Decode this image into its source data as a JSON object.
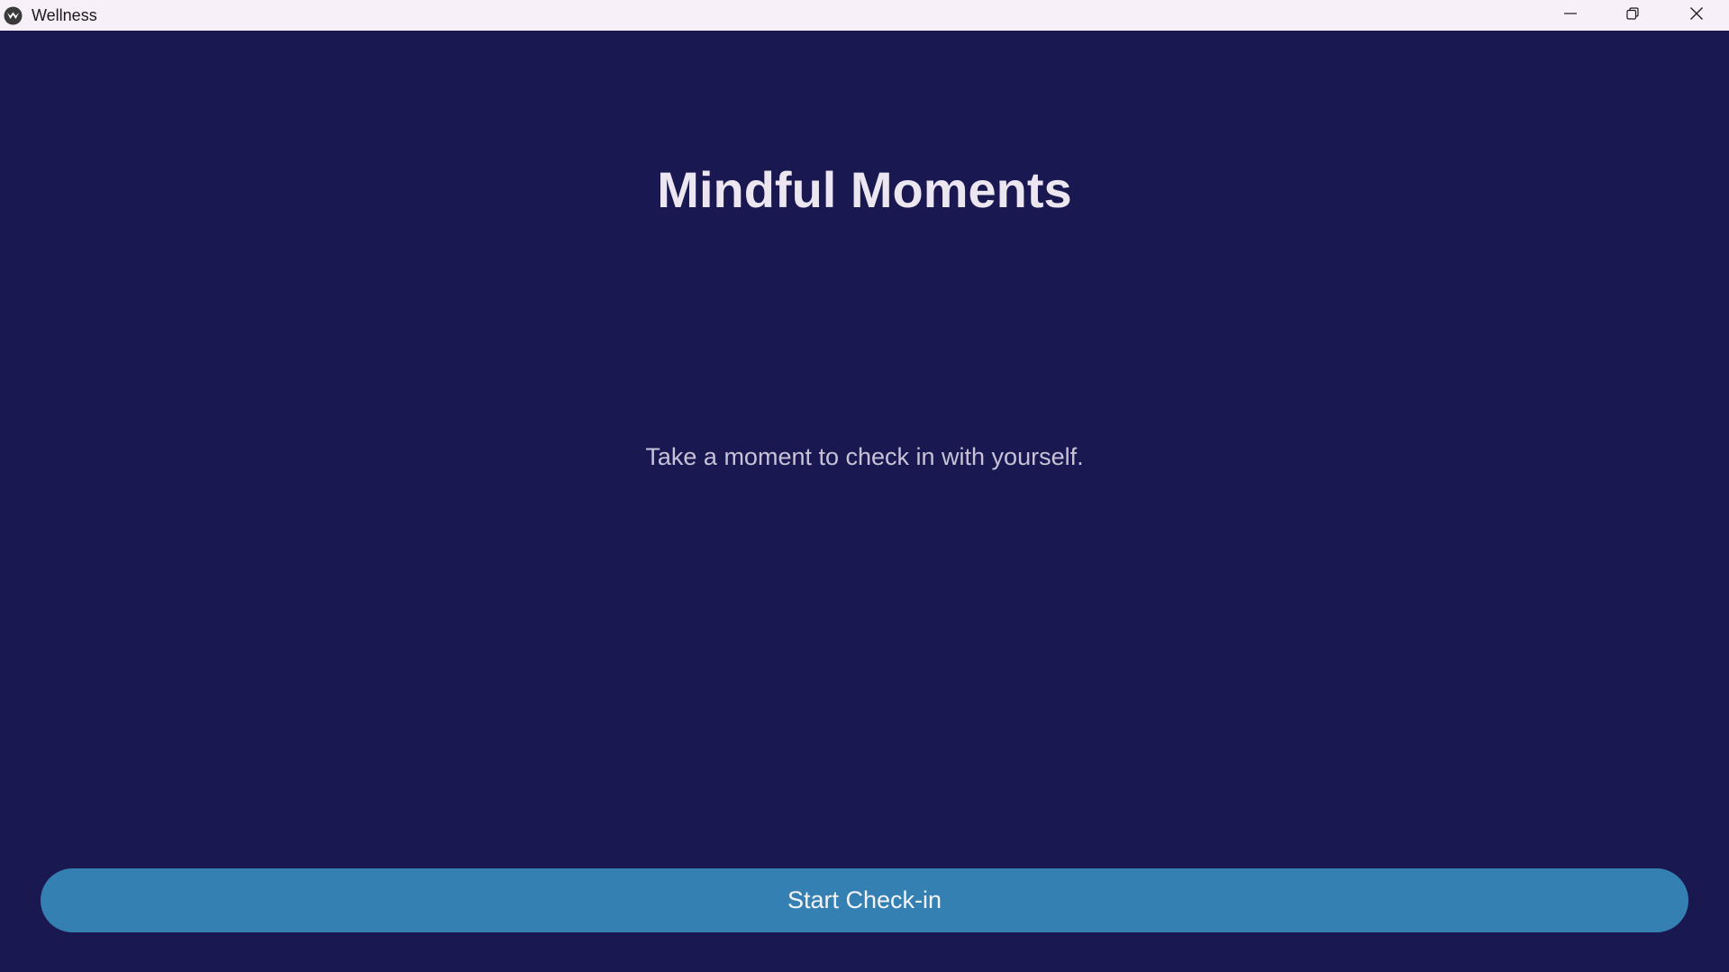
{
  "window": {
    "title": "Wellness",
    "app_icon": "wellness-logo-icon",
    "controls": {
      "minimize_icon": "minimize-icon",
      "maximize_icon": "restore-icon",
      "close_icon": "close-icon"
    }
  },
  "main": {
    "heading": "Mindful Moments",
    "subtitle": "Take a moment to check in with yourself.",
    "start_button_label": "Start Check-in"
  },
  "colors": {
    "background": "#1a1850",
    "titlebar": "#f8f0f8",
    "button": "#3580b3",
    "heading_text": "#ebe6f0",
    "subtitle_text": "#c8c2d8"
  }
}
